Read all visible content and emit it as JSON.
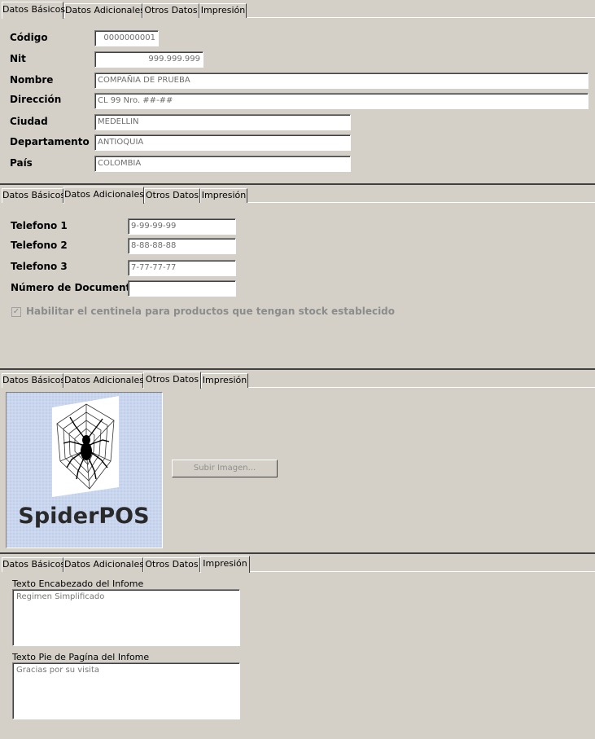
{
  "tabs": [
    "Datos Básicos",
    "Datos Adicionales",
    "Otros Datos",
    "Impresión"
  ],
  "basicos": {
    "codigo_label": "Código",
    "codigo": "0000000001",
    "nit_label": "Nit",
    "nit": "999.999.999",
    "nombre_label": "Nombre",
    "nombre": "COMPAÑIA DE PRUEBA",
    "direccion_label": "Dirección",
    "direccion": "CL 99 Nro. ##-##",
    "ciudad_label": "Ciudad",
    "ciudad": "MEDELLIN",
    "departamento_label": "Departamento",
    "departamento": "ANTIOQUIA",
    "pais_label": "País",
    "pais": "COLOMBIA"
  },
  "adicionales": {
    "tel1_label": "Telefono 1",
    "tel1": "9-99-99-99",
    "tel2_label": "Telefono 2",
    "tel2": "8-88-88-88",
    "tel3_label": "Telefono 3",
    "tel3": "7-77-77-77",
    "doc_label": "Número de Documento",
    "doc": "",
    "centinela_label": "Habilitar el centinela para productos que tengan stock establecido",
    "centinela_checked": true
  },
  "otros": {
    "logo_text": "SpiderPOS",
    "upload_label": "Subir Imagen..."
  },
  "impresion": {
    "encabezado_label": "Texto Encabezado del Infome",
    "encabezado": "Regimen Simplificado",
    "pie_label": "Texto Pie de Pagína del Infome",
    "pie": "Gracias por su visita"
  }
}
